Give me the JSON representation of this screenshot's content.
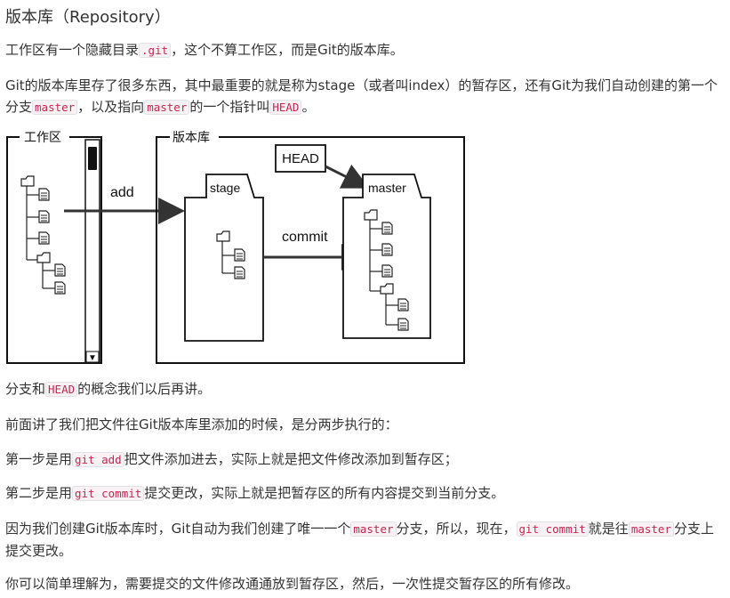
{
  "title": "版本库（Repository）",
  "paragraphs": {
    "p1": {
      "t1": "工作区有一个隐藏目录",
      "c1": ".git",
      "t2": "，这个不算工作区，而是Git的版本库。"
    },
    "p2": {
      "t1": "Git的版本库里存了很多东西，其中最重要的就是称为stage（或者叫index）的暂存区，还有Git为我们自动创建的第一个分支",
      "c1": "master",
      "t2": "，以及指向",
      "c2": "master",
      "t3": "的一个指针叫",
      "c3": "HEAD",
      "t4": "。"
    },
    "p3": {
      "t1": "分支和",
      "c1": "HEAD",
      "t2": "的概念我们以后再讲。"
    },
    "p4": {
      "t1": "前面讲了我们把文件往Git版本库里添加的时候，是分两步执行的："
    },
    "p5": {
      "t1": "第一步是用",
      "c1": "git add",
      "t2": "把文件添加进去，实际上就是把文件修改添加到暂存区；"
    },
    "p6": {
      "t1": "第二步是用",
      "c1": "git commit",
      "t2": "提交更改，实际上就是把暂存区的所有内容提交到当前分支。"
    },
    "p7": {
      "t1": "因为我们创建Git版本库时，Git自动为我们创建了唯一一个",
      "c1": "master",
      "t2": "分支，所以，现在，",
      "c2": "git commit",
      "t3": "就是往",
      "c3": "master",
      "t4": "分支上提交更改。"
    },
    "p8": {
      "t1": "你可以简单理解为，需要提交的文件修改通通放到暂存区，然后，一次性提交暂存区的所有修改。"
    }
  },
  "diagram": {
    "workspace_label": "工作区",
    "repo_label": "版本库",
    "add_label": "add",
    "commit_label": "commit",
    "stage_label": "stage",
    "master_label": "master",
    "head_label": "HEAD",
    "scrollbar_up": "▲",
    "scrollbar_down": "▼"
  }
}
